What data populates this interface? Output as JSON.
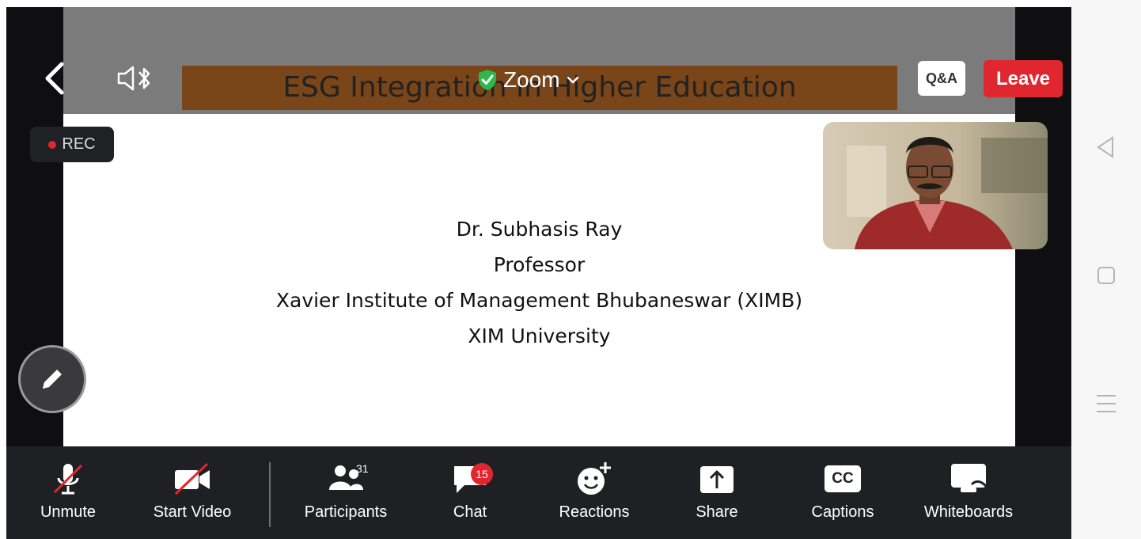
{
  "slide": {
    "title": "ESG Integration in Higher Education",
    "lines": [
      "Dr. Subhasis Ray",
      "Professor",
      "Xavier Institute of Management Bhubaneswar (XIMB)",
      "XIM University"
    ]
  },
  "topbar": {
    "meeting_title": "Zoom",
    "qa_label": "Q&A",
    "leave_label": "Leave"
  },
  "recording": {
    "label": "REC"
  },
  "toolbar": {
    "unmute_label": "Unmute",
    "start_video_label": "Start Video",
    "participants_label": "Participants",
    "participants_count": "31",
    "chat_label": "Chat",
    "chat_badge": "15",
    "reactions_label": "Reactions",
    "share_label": "Share",
    "captions_label": "Captions",
    "captions_icon_text": "CC",
    "whiteboards_label": "Whiteboards"
  },
  "colors": {
    "leave": "#e0262f",
    "title_bar": "#7a4518",
    "secure_shield": "#2db84d"
  },
  "icons": [
    "back-icon",
    "speaker-bluetooth-icon",
    "shield-check-icon",
    "chevron-down-icon",
    "pencil-icon",
    "mic-off-icon",
    "video-off-icon",
    "participants-icon",
    "chat-icon",
    "reactions-icon",
    "share-icon",
    "captions-icon",
    "whiteboard-icon",
    "nav-back-icon",
    "nav-home-icon",
    "nav-menu-icon"
  ]
}
